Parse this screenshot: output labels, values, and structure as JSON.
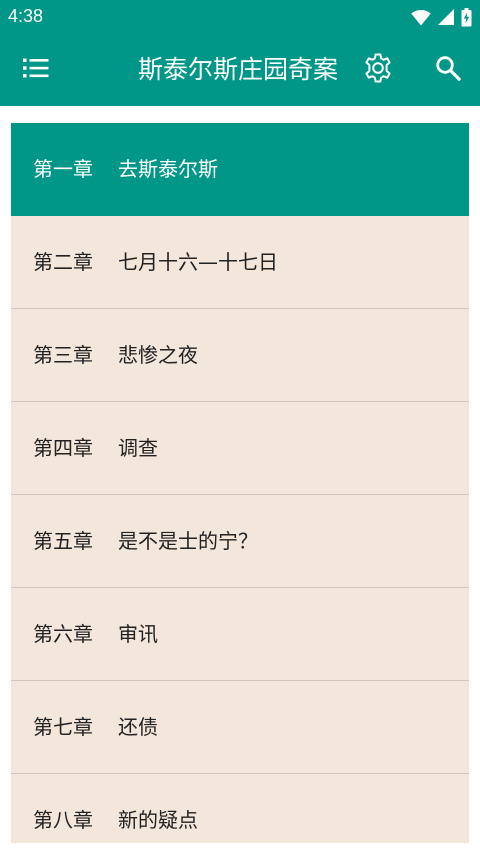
{
  "status_bar": {
    "time": "4:38",
    "icons": [
      "wifi-icon",
      "signal-icon",
      "battery-charging-icon"
    ]
  },
  "app_bar": {
    "title": "斯泰尔斯庄园奇案",
    "left_icon": "menu-list-icon",
    "right_icons": [
      "gear-icon",
      "search-icon"
    ]
  },
  "colors": {
    "primary": "#009688",
    "list_background": "#f2e7da",
    "divider": "#cfc6ba",
    "text": "#222222",
    "active_text": "#ffffff"
  },
  "chapters": [
    {
      "number": "第一章",
      "title": "去斯泰尔斯",
      "active": true
    },
    {
      "number": "第二章",
      "title": "七月十六—十七日",
      "active": false
    },
    {
      "number": "第三章",
      "title": "悲惨之夜",
      "active": false
    },
    {
      "number": "第四章",
      "title": "调查",
      "active": false
    },
    {
      "number": "第五章",
      "title": "是不是士的宁？",
      "active": false
    },
    {
      "number": "第六章",
      "title": "审讯",
      "active": false
    },
    {
      "number": "第七章",
      "title": "还债",
      "active": false
    },
    {
      "number": "第八章",
      "title": "新的疑点",
      "active": false
    }
  ]
}
